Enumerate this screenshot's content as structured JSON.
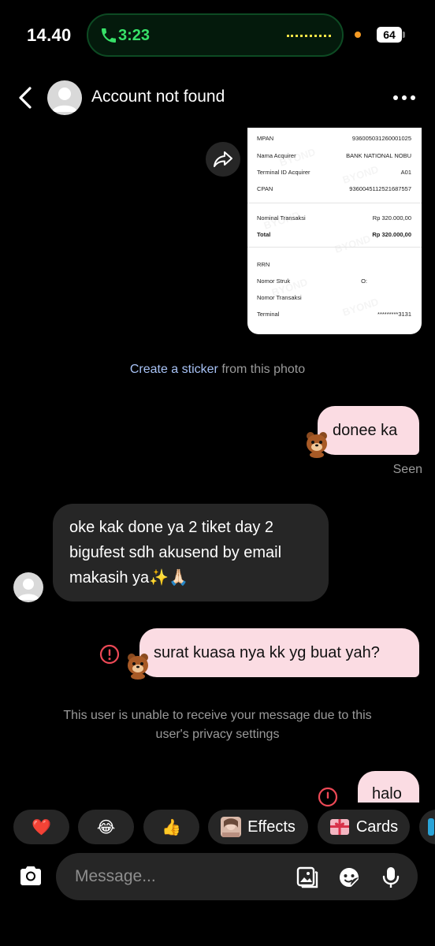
{
  "status_bar": {
    "time": "14.40",
    "call_duration": "3:23",
    "battery": "64"
  },
  "header": {
    "title": "Account not found"
  },
  "receipt": {
    "watermark": "BYOND",
    "rows": [
      {
        "label": "MPAN",
        "value": "936005031260001025"
      },
      {
        "label": "Nama Acquirer",
        "value": "BANK NATIONAL NOBU"
      },
      {
        "label": "Terminal ID Acquirer",
        "value": "A01"
      },
      {
        "label": "CPAN",
        "value": "9360045112521687557"
      },
      {
        "label": "Nominal Transaksi",
        "value": "Rp 320.000,00"
      },
      {
        "label": "Total",
        "value": "Rp 320.000,00"
      },
      {
        "label": "RRN",
        "value": ""
      },
      {
        "label": "Nomor Struk",
        "value": "O:"
      },
      {
        "label": "Nomor Transaksi",
        "value": ""
      },
      {
        "label": "Terminal",
        "value": "*********3131"
      }
    ]
  },
  "chat": {
    "sticker_link": "Create a sticker",
    "sticker_rest": " from this photo",
    "msg_out_1": "donee ka",
    "seen": "Seen",
    "msg_in_1_line1": "oke kak done ya 2 tiket day 2",
    "msg_in_1_line2": "bigufest sdh akusend by email",
    "msg_in_1_line3": "makasih ya✨🙏🏻",
    "msg_out_2": "surat kuasa nya kk yg buat yah?",
    "privacy_line1": "This user is unable to receive your message due to this",
    "privacy_line2": "user's privacy settings",
    "msg_out_3": "halo"
  },
  "quick_actions": {
    "heart": "❤️",
    "laugh": "😂",
    "thumbs": "👍",
    "effects": "Effects",
    "cards": "Cards"
  },
  "composer": {
    "placeholder": "Message..."
  },
  "colors": {
    "outgoing_bubble": "#fbdce3",
    "incoming_bubble": "#262626",
    "call_green": "#37e068",
    "link_blue": "#a7c2f5",
    "error_red": "#ed4956"
  }
}
